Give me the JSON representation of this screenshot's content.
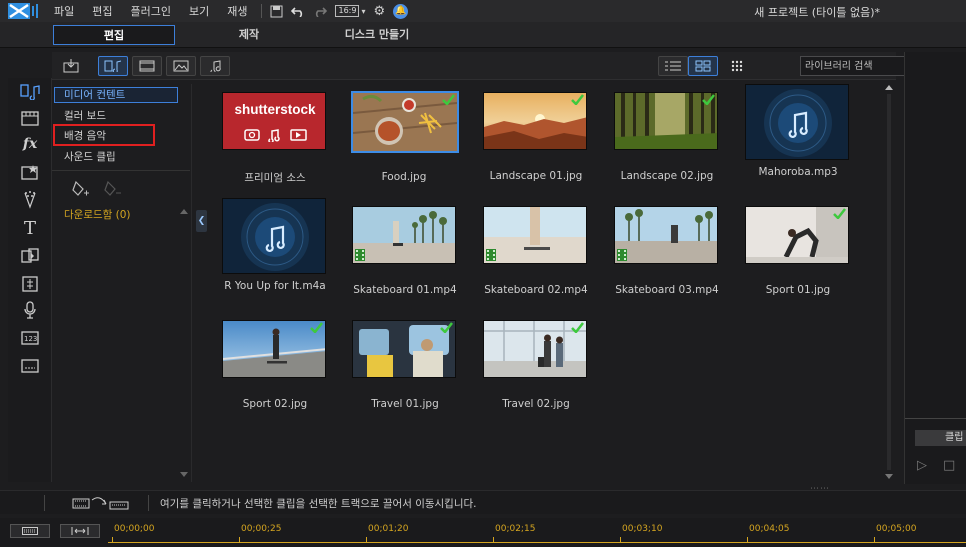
{
  "menu": {
    "items": [
      "파일",
      "편집",
      "플러그인",
      "보기",
      "재생"
    ],
    "aspect_ratio": "16:9",
    "project_title": "새 프로젝트 (타이틀 없음)*"
  },
  "modes": {
    "tabs": [
      "편집",
      "제작",
      "디스크 만들기"
    ],
    "active": "편집"
  },
  "toolbar": {
    "search_placeholder": "라이브러리 검색"
  },
  "categories": {
    "items": [
      "미디어 컨텐트",
      "컬러 보드",
      "배경 음악",
      "사운드 클립"
    ],
    "selected": "미디어 컨텐트",
    "highlighted": "배경 음악",
    "download_label": "다운로드함  (0)"
  },
  "library": {
    "items": [
      {
        "label": "프리미엄 소스",
        "kind": "shutterstock",
        "brand": "shutterstock"
      },
      {
        "label": "Food.jpg",
        "kind": "photo",
        "checked": true,
        "selected": true
      },
      {
        "label": "Landscape 01.jpg",
        "kind": "photo",
        "checked": true
      },
      {
        "label": "Landscape 02.jpg",
        "kind": "photo",
        "checked": true
      },
      {
        "label": "Mahoroba.mp3",
        "kind": "audio"
      },
      {
        "label": "R You Up for It.m4a",
        "kind": "audio"
      },
      {
        "label": "Skateboard 01.mp4",
        "kind": "video"
      },
      {
        "label": "Skateboard 02.mp4",
        "kind": "video"
      },
      {
        "label": "Skateboard 03.mp4",
        "kind": "video"
      },
      {
        "label": "Sport 01.jpg",
        "kind": "photo",
        "checked": true
      },
      {
        "label": "Sport 02.jpg",
        "kind": "photo",
        "checked": true
      },
      {
        "label": "Travel 01.jpg",
        "kind": "photo",
        "checked": true
      },
      {
        "label": "Travel 02.jpg",
        "kind": "photo",
        "checked": true
      }
    ]
  },
  "preview": {
    "clip_tab": "클립"
  },
  "timeline": {
    "hint": "여기를 클릭하거나 선택한 클립을 선택한 트랙으로 끌어서 이동시킵니다.",
    "ticks": [
      "00;00;00",
      "00;00;25",
      "00;01;20",
      "00;02;15",
      "00;03;10",
      "00;04;05",
      "00;05;00"
    ]
  },
  "colors": {
    "accent": "#3d7fd9",
    "highlight_red": "#e02020",
    "timeline_gold": "#d4a520",
    "check_green": "#3ec93e"
  }
}
